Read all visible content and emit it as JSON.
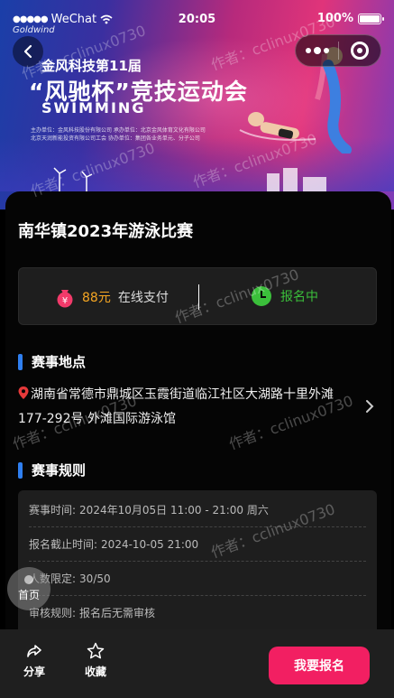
{
  "status_bar": {
    "carrier": "WeChat",
    "time": "20:05",
    "battery": "100%"
  },
  "banner": {
    "brand": "Goldwind",
    "title_line1": "金风科技第11届",
    "title_line2": "“风驰杯”竞技运动会",
    "title_line3": "SWIMMING",
    "sub_lines": [
      "主办单位：金风科技股份有限公司   承办单位：北京金风体育文化有限公司",
      "北京天润新能投资有限公司工会   协办单位：集团各业务单元、分子公司"
    ]
  },
  "event": {
    "title": "南华镇2023年游泳比赛",
    "price": "88元",
    "pay_mode": "在线支付",
    "status": "报名中"
  },
  "location_section": {
    "heading": "赛事地点",
    "address": "湖南省常德市鼎城区玉霞街道临江社区大湖路十里外滩177-292号 外滩国际游泳馆"
  },
  "rules_section": {
    "heading": "赛事规则",
    "rows": [
      {
        "key": "赛事时间:",
        "value": "2024年10月05日 11:00 - 21:00 周六"
      },
      {
        "key": "报名截止时间:",
        "value": "2024-10-05 21:00"
      },
      {
        "key": "人数限定:",
        "value": "30/50"
      },
      {
        "key": "审核规则:",
        "value": "报名后无需审核"
      }
    ]
  },
  "float_home": {
    "label": "首页"
  },
  "bottom_bar": {
    "share_label": "分享",
    "favorite_label": "收藏",
    "signup_label": "我要报名"
  },
  "watermark": "作者：cclinux0730",
  "colors": {
    "accent_blue": "#2f7ff0",
    "signup_pink": "#f21f62",
    "price_orange": "#f5a623",
    "status_green": "#3bbf3b"
  }
}
